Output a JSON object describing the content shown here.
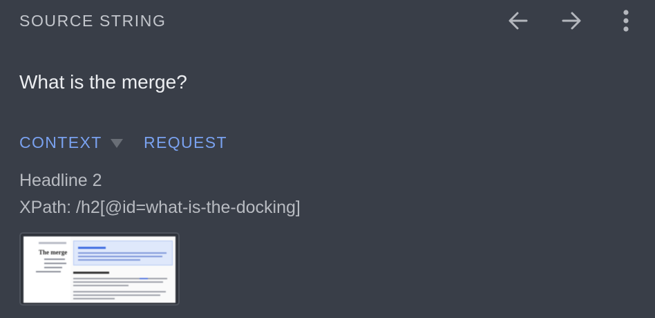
{
  "header": {
    "label": "SOURCE STRING",
    "prev_icon": "arrow-left-icon",
    "next_icon": "arrow-right-icon",
    "more_icon": "more-vert-icon"
  },
  "source": {
    "text": "What is the merge?"
  },
  "tabs": [
    {
      "label": "CONTEXT",
      "icon": "caret-down-icon"
    },
    {
      "label": "REQUEST"
    }
  ],
  "context": {
    "element_type": "Headline 2",
    "xpath": "XPath: /h2[@id=what-is-the-docking]"
  },
  "screenshot_thumbnail": {
    "page_title": "The merge"
  },
  "colors": {
    "background": "#393e48",
    "accent": "#7aa2f0",
    "primary_text": "#eceef1",
    "secondary_text": "#b8bbc1"
  }
}
